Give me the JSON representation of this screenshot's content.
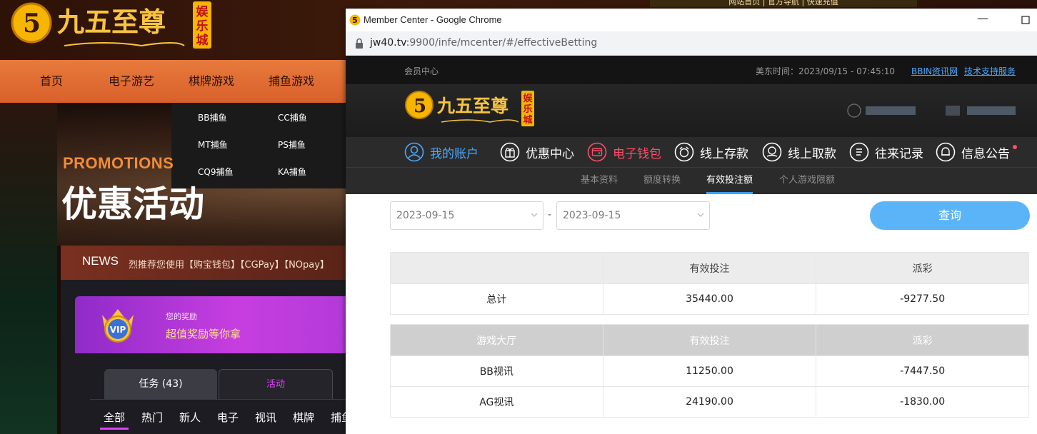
{
  "bg_site": {
    "logo_text": "九五至尊",
    "logo_badge": "娱乐城",
    "top_links": "网站首页 | 官方导航 | 快速充值",
    "nav": [
      "首页",
      "电子游艺",
      "棋牌游戏",
      "捕鱼游戏"
    ],
    "dropdown": [
      "BB捕鱼",
      "CC捕鱼",
      "MT捕鱼",
      "PS捕鱼",
      "CQ9捕鱼",
      "KA捕鱼"
    ],
    "promotions_en": "PROMOTIONS",
    "promotions_cn": "优惠活动",
    "news_label": "NEWS",
    "news_text": "烈推荐您使用【购宝钱包】【CGPay】【NOpay】",
    "vip_badge": "VIP",
    "vip_small": "您的奖励",
    "vip_big": "超值奖励等你拿",
    "tab_task": "任务 (43)",
    "tab_activity": "活动",
    "categories": [
      "全部",
      "热门",
      "新人",
      "电子",
      "视讯",
      "棋牌",
      "捕鱼"
    ]
  },
  "window": {
    "title": "Member Center - Google Chrome",
    "url_host": "jw40.tv",
    "url_rest": ":9900/infe/mcenter/#/effectiveBetting"
  },
  "member": {
    "topbar_left": "会员中心",
    "topbar_time": "美东时间：2023/09/15 - 07:45:10",
    "link1": "BBIN资讯网",
    "link2": "技术支持服务",
    "logo_text": "九五至尊",
    "logo_badge": "娱乐城",
    "nav": [
      {
        "label": "我的账户",
        "color": "#4aa8ff"
      },
      {
        "label": "优惠中心",
        "color": "#ffffff"
      },
      {
        "label": "电子钱包",
        "color": "#ff4d6a"
      },
      {
        "label": "线上存款",
        "color": "#ffffff"
      },
      {
        "label": "线上取款",
        "color": "#ffffff"
      },
      {
        "label": "往来记录",
        "color": "#ffffff"
      },
      {
        "label": "信息公告",
        "color": "#ffffff"
      }
    ],
    "subnav": [
      "基本资料",
      "额度转换",
      "有效投注额",
      "个人游戏限额"
    ],
    "subnav_active": "有效投注额"
  },
  "filter": {
    "date_from": "2023-09-15",
    "date_to": "2023-09-15",
    "separator": "-",
    "query_label": "查询"
  },
  "summary_table": {
    "headers": [
      "",
      "有效投注",
      "派彩"
    ],
    "row": [
      "总计",
      "35440.00",
      "-9277.50"
    ]
  },
  "detail_table": {
    "headers": [
      "游戏大厅",
      "有效投注",
      "派彩"
    ],
    "rows": [
      [
        "BB视讯",
        "11250.00",
        "-7447.50"
      ],
      [
        "AG视讯",
        "24190.00",
        "-1830.00"
      ]
    ]
  },
  "colors": {
    "accent_blue": "#3aa0ff",
    "query_button": "#5bb4f8",
    "wallet_red": "#ff4d6a",
    "bg_nav_orange": "#e06a30"
  }
}
